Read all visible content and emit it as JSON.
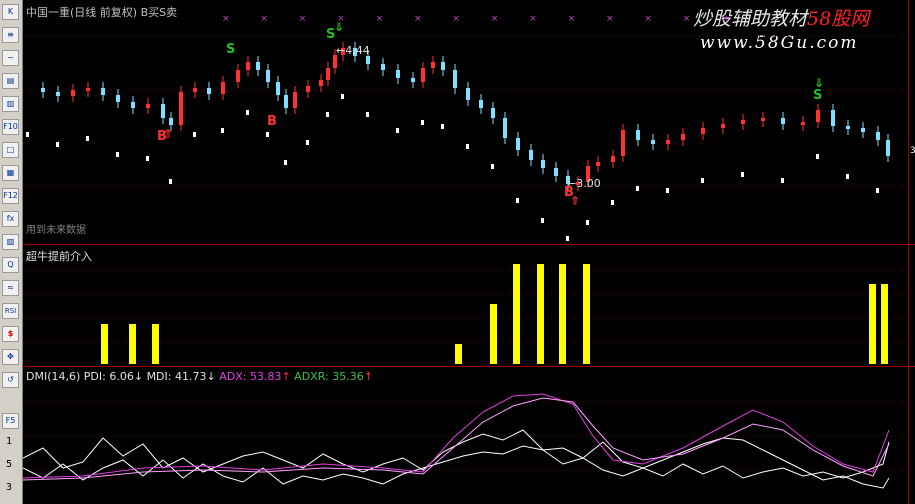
{
  "window": {
    "title": "中国一重(日线 前复权) B买S卖"
  },
  "watermark": {
    "line1_prefix": "炒股辅助教材",
    "line1_brand": "58股网",
    "line2": "www.58Gu.com"
  },
  "main_panel": {
    "future_data_note": "用到未来数据",
    "high_label": "4.44",
    "low_label": "3.00",
    "signals": [
      {
        "type": "S",
        "color": "#20c020"
      },
      {
        "type": "S",
        "color": "#20c020"
      },
      {
        "type": "S",
        "color": "#20c020"
      },
      {
        "type": "B",
        "color": "#ff3030"
      },
      {
        "type": "B",
        "color": "#ff3030"
      },
      {
        "type": "B",
        "color": "#ff3030"
      }
    ],
    "top_markers": "× × × × × × × × × × × × × ×",
    "right_tick": "3"
  },
  "indicator_panel": {
    "title": "超牛提前介入",
    "bar_color": "#ffff00",
    "chart_data": {
      "type": "bar",
      "title": "超牛提前介入",
      "levels": [
        2,
        2,
        2,
        1,
        3,
        5,
        5,
        5,
        5,
        4,
        4
      ],
      "ylim": [
        0,
        5
      ]
    }
  },
  "dmi_panel": {
    "name": "DMI(14,6)",
    "pdi_label": "PDI:",
    "pdi_value": "6.06",
    "pdi_arrow": "↓",
    "mdi_label": "MDI:",
    "mdi_value": "41.73",
    "mdi_arrow": "↓",
    "adx_label": "ADX:",
    "adx_value": "53.83",
    "adx_arrow": "↑",
    "adxr_label": "ADXR:",
    "adxr_value": "35.36",
    "adxr_arrow": "↑",
    "colors": {
      "pdi": "#ffffff",
      "mdi": "#ffffff",
      "adx": "#e040e0",
      "adxr": "#40c040"
    }
  },
  "toolbar": {
    "buttons": [
      "K",
      "≡",
      "~",
      "▤",
      "▥",
      "F10",
      "□",
      "▦",
      "F12",
      "fx",
      "▧",
      "Q",
      "≈",
      "RSI",
      "$",
      "✥",
      "↺",
      "F5"
    ],
    "numbers": [
      "1",
      "5",
      "3"
    ]
  }
}
